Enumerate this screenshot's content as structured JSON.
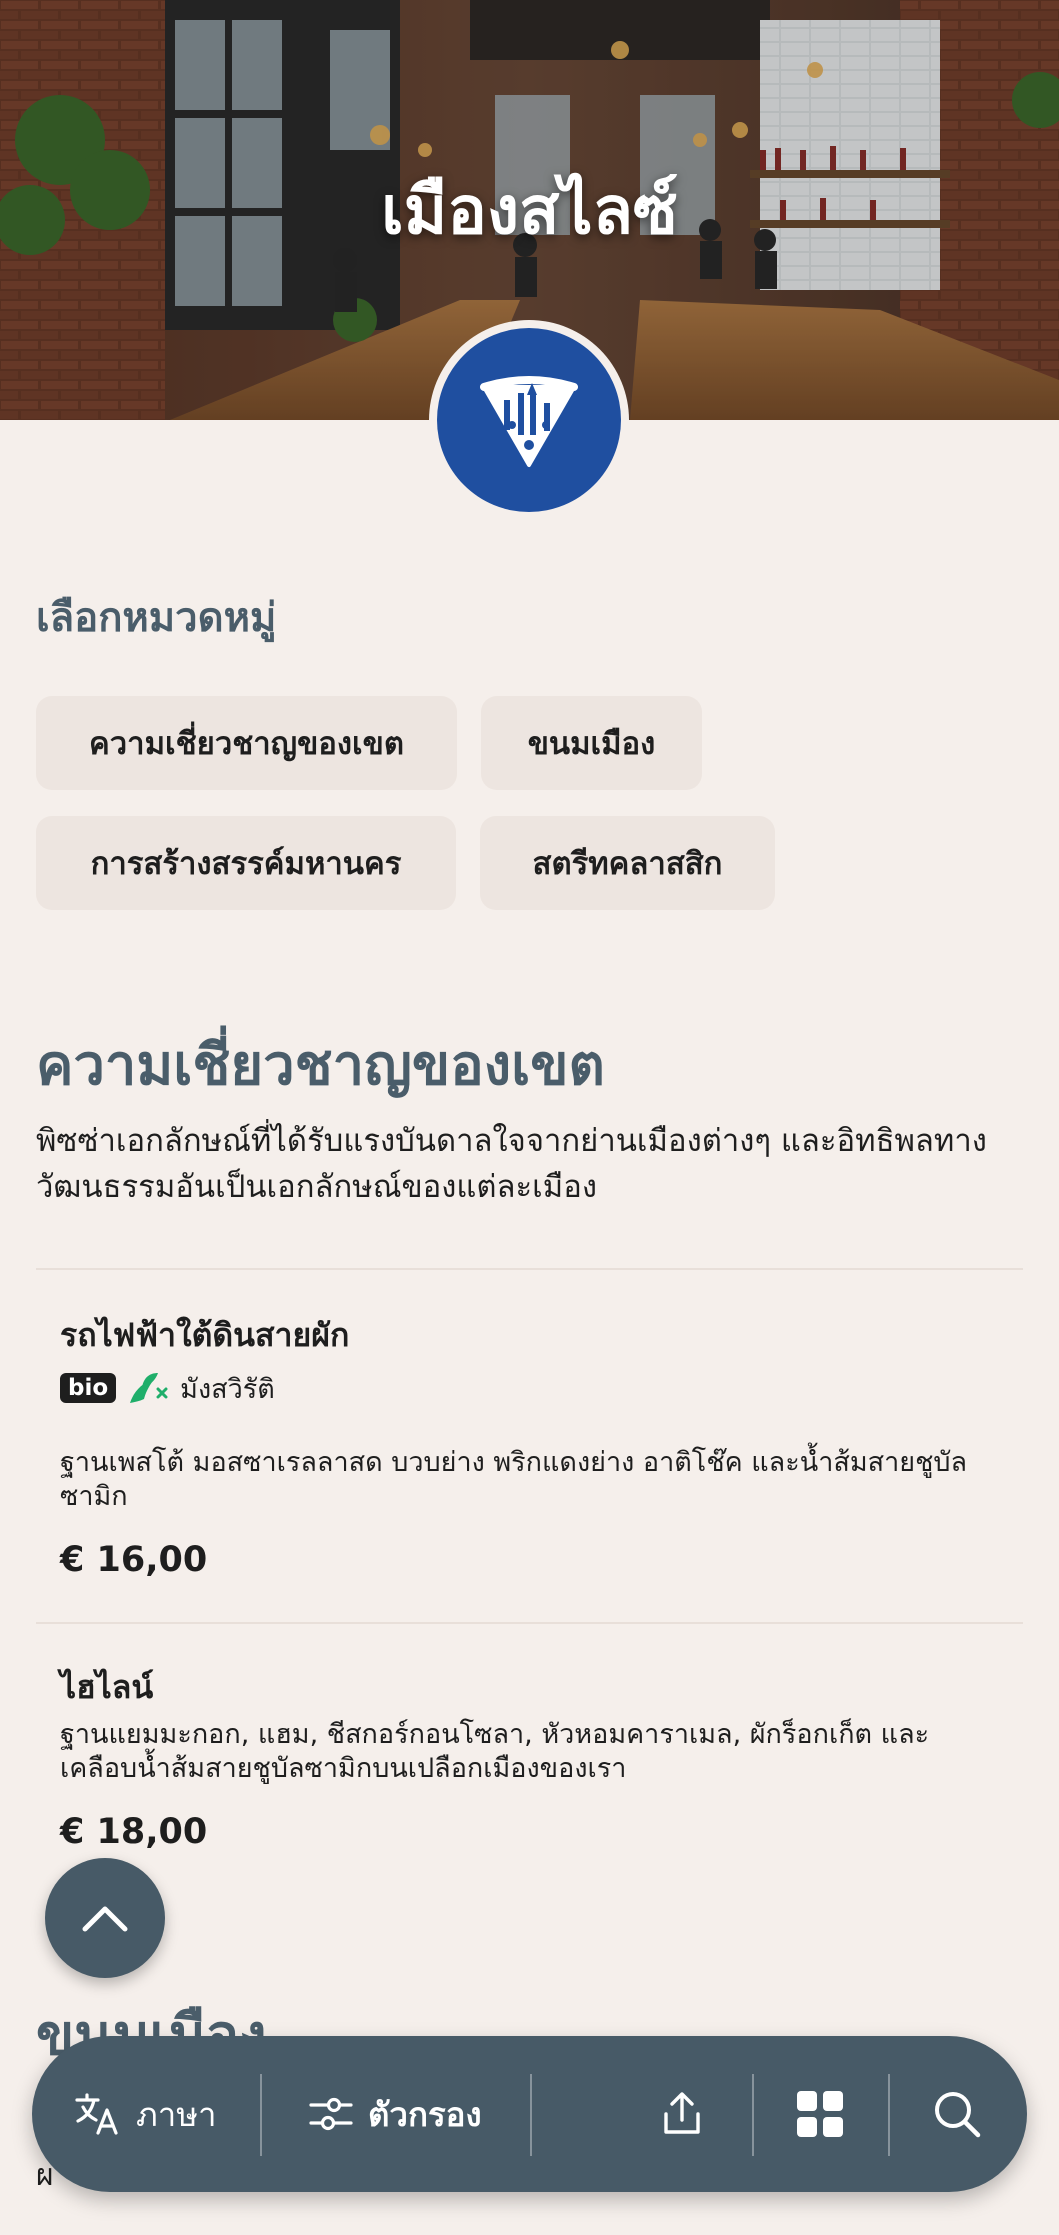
{
  "restaurant": {
    "name": "เมืองสไลซ์",
    "brand_color": "#1f4fa0"
  },
  "category_select": {
    "label": "เลือกหมวดหมู่",
    "chips": [
      "ความเชี่ยวชาญของเขต",
      "ขนมเมือง",
      "การสร้างสรรค์มหานคร",
      "สตรีทคลาสสิก"
    ]
  },
  "menu": {
    "section": {
      "title": "ความเชี่ยวชาญของเขต",
      "description": "พิซซ่าเอกลักษณ์ที่ได้รับแรงบันดาลใจจากย่านเมืองต่างๆ และอิทธิพลทางวัฒนธรรมอันเป็นเอกลักษณ์ของแต่ละเมือง"
    },
    "items": [
      {
        "name": "รถไฟฟ้าใต้ดินสายผัก",
        "badge": "bio",
        "diet_icon": "vegetarian-icon",
        "diet_label": "มังสวิรัติ",
        "description": "ฐานเพสโต้ มอสซาเรลลาสด บวบย่าง พริกแดงย่าง อาติโช๊ค และน้ำส้มสายชูบัลซามิก",
        "price": "€ 16,00"
      },
      {
        "name": "ไฮไลน์",
        "description": "ฐานแยมมะกอก, แฮม, ชีสกอร์กอนโซลา, หัวหอมคาราเมล, ผักร็อกเก็ต และเคลือบน้ำส้มสายชูบัลซามิกบนเปลือกเมืองของเรา",
        "price": "€ 18,00"
      }
    ],
    "next_section_title": "ขนมเมือง",
    "next_section_peek": "ผ"
  },
  "bottom_bar": {
    "language_label": "ภาษา",
    "filter_label": "ตัวกรอง",
    "bar_color": "#475a67"
  }
}
